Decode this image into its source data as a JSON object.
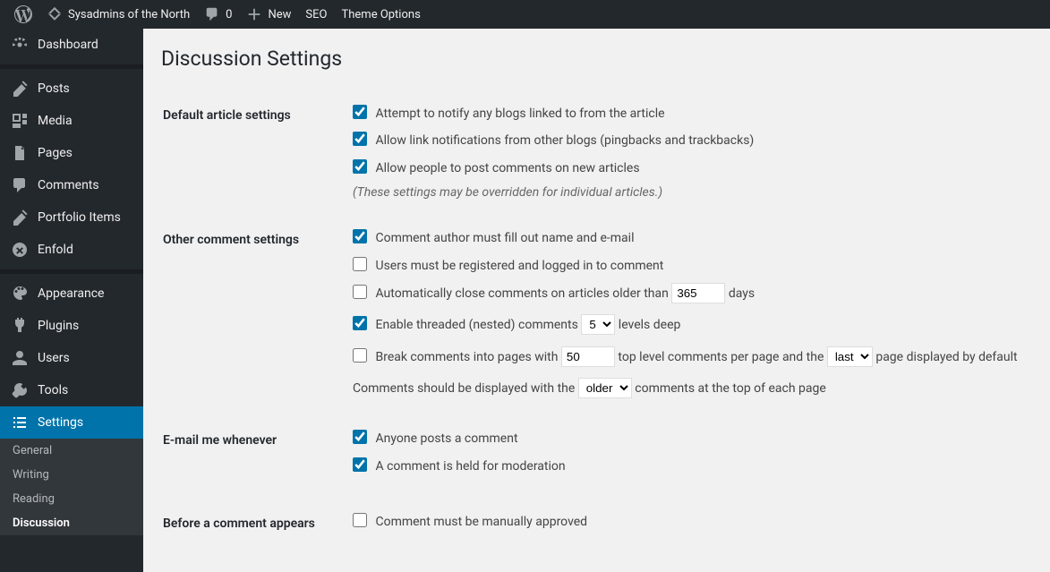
{
  "adminbar": {
    "site_name": "Sysadmins of the North",
    "comments_count": "0",
    "new_label": "New",
    "seo_label": "SEO",
    "theme_options_label": "Theme Options"
  },
  "sidebar": {
    "dashboard": "Dashboard",
    "posts": "Posts",
    "media": "Media",
    "pages": "Pages",
    "comments": "Comments",
    "portfolio": "Portfolio Items",
    "enfold": "Enfold",
    "appearance": "Appearance",
    "plugins": "Plugins",
    "users": "Users",
    "tools": "Tools",
    "settings": "Settings",
    "submenu": {
      "general": "General",
      "writing": "Writing",
      "reading": "Reading",
      "discussion": "Discussion"
    }
  },
  "page": {
    "title": "Discussion Settings",
    "sections": {
      "default_article": {
        "heading": "Default article settings",
        "opt1": "Attempt to notify any blogs linked to from the article",
        "opt2": "Allow link notifications from other blogs (pingbacks and trackbacks)",
        "opt3": "Allow people to post comments on new articles",
        "note": "(These settings may be overridden for individual articles.)"
      },
      "other_comment": {
        "heading": "Other comment settings",
        "opt1": "Comment author must fill out name and e-mail",
        "opt2": "Users must be registered and logged in to comment",
        "autoclose_pre": "Automatically close comments on articles older than ",
        "autoclose_days": "365",
        "autoclose_post": " days",
        "threaded_pre": "Enable threaded (nested) comments ",
        "threaded_level": "5",
        "threaded_post": " levels deep",
        "paginate_pre": "Break comments into pages with ",
        "paginate_count": "50",
        "paginate_mid": " top level comments per page and the ",
        "paginate_default": "last",
        "paginate_post": " page displayed by default",
        "order_pre": "Comments should be displayed with the ",
        "order_value": "older",
        "order_post": " comments at the top of each page"
      },
      "email_me": {
        "heading": "E-mail me whenever",
        "opt1": "Anyone posts a comment",
        "opt2": "A comment is held for moderation"
      },
      "before_appears": {
        "heading": "Before a comment appears",
        "opt1": "Comment must be manually approved"
      }
    }
  }
}
